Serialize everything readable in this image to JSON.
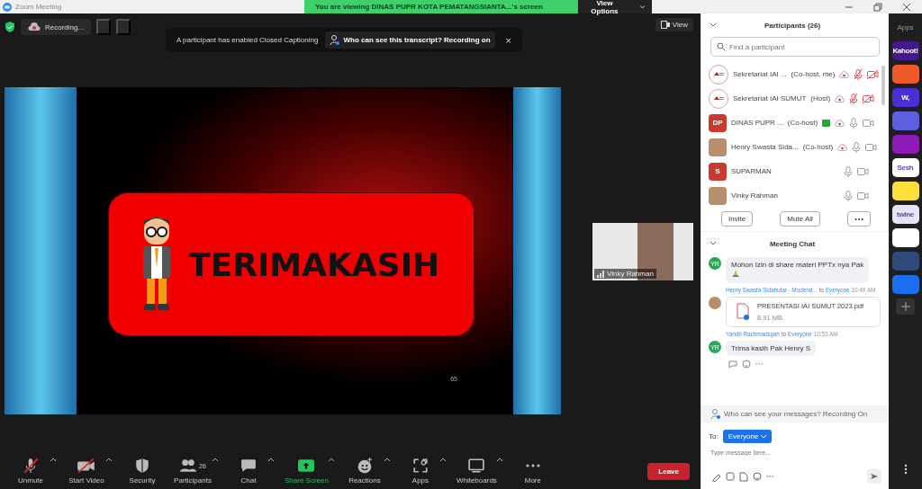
{
  "window": {
    "title": "Zoom Meeting"
  },
  "share_banner": {
    "text": "You are viewing DINAS PUPR KOTA PEMATANGSIANTA...'s screen",
    "button": "View Options"
  },
  "recording": {
    "label": "Recording..."
  },
  "caption_notice": {
    "text": "A participant has enabled Closed Captioning",
    "link": "Who can see this transcript? Recording on",
    "close": "×"
  },
  "view_button": "View",
  "slide": {
    "title": "TERIMAKASIH",
    "page": "65"
  },
  "thumbnail": {
    "name": "Vinky Rahman"
  },
  "toolbar": [
    {
      "kind": "mic",
      "label": "Unmute",
      "off": true
    },
    {
      "kind": "video",
      "label": "Start Video",
      "off": true
    },
    {
      "kind": "security",
      "label": "Security"
    },
    {
      "kind": "participants",
      "label": "Participants",
      "count": "26"
    },
    {
      "kind": "chat",
      "label": "Chat"
    },
    {
      "kind": "share",
      "label": "Share Screen"
    },
    {
      "kind": "reactions",
      "label": "Reactions"
    },
    {
      "kind": "apps",
      "label": "Apps"
    },
    {
      "kind": "whiteboards",
      "label": "Whiteboards"
    },
    {
      "kind": "more",
      "label": "More"
    }
  ],
  "leave_button": "Leave",
  "participants": {
    "title": "Participants (26)",
    "search_placeholder": "Find a participant",
    "rows": [
      {
        "name": "Sekretariat IAI ...",
        "role": "(Co-host, me)",
        "avatar": {
          "kind": "logo"
        },
        "recording": true,
        "sharing": false,
        "mic_muted": true,
        "video_off": true
      },
      {
        "name": "Sekretariat IAI SUMUT",
        "role": "(Host)",
        "avatar": {
          "kind": "logo"
        },
        "recording": true,
        "sharing": false,
        "mic_muted": true,
        "video_off": true
      },
      {
        "name": "DINAS PUPR ...",
        "role": "(Co-host)",
        "avatar": {
          "kind": "initials",
          "initials": "DP"
        },
        "recording": true,
        "sharing": true,
        "mic_muted": false,
        "video_off": false
      },
      {
        "name": "Henry Swasta Sida...",
        "role": "(Co-host)",
        "avatar": {
          "kind": "photo"
        },
        "recording": true,
        "sharing": false,
        "mic_muted": false,
        "video_off": false
      },
      {
        "name": "SUPARMAN",
        "avatar": {
          "kind": "initials",
          "initials": "S"
        },
        "recording": false,
        "sharing": false,
        "mic_muted": false,
        "video_off": false
      },
      {
        "name": "Vinky Rahman",
        "avatar": {
          "kind": "photo"
        },
        "recording": false,
        "sharing": false,
        "mic_muted": false,
        "video_off": false
      }
    ],
    "buttons": [
      "Invite",
      "Mute All"
    ]
  },
  "chat": {
    "title": "Meeting Chat",
    "messages": [
      {
        "kind": "text",
        "avatar": {
          "kind": "initials",
          "initials": "YR"
        },
        "text": "Mohon Izin di share materi PPTx nya Pak",
        "prayer_emoji": true
      },
      {
        "kind": "file",
        "avatar": {
          "kind": "photo"
        },
        "sender": "Henry Swasta Sidabutar - Moderat...",
        "to": "to",
        "recipient": "Everyone",
        "time": "10:49 AM",
        "file_name": "PRESENTASI IAI SUMUT 2023.pdf",
        "file_size": "8.91 MB"
      },
      {
        "kind": "text",
        "avatar": {
          "kind": "initials",
          "initials": "YR"
        },
        "sender": "Yandri Rachmadsyah",
        "to": "to",
        "recipient": "Everyone",
        "time": "10:53 AM",
        "text": "Trima kasih Pak Henry S",
        "prayer_emoji": false
      }
    ],
    "privacy": "Who can see your messages? Recording On",
    "to_label": "To:",
    "recipient": "Everyone",
    "placeholder": "Type message here..."
  },
  "apps": {
    "title": "Apps",
    "items": [
      {
        "label": "Kahoot!",
        "color": "#46178f"
      },
      {
        "color": "#f05a28"
      },
      {
        "label": "W,",
        "color": "#4b2fd6"
      },
      {
        "color": "#5b5fe0"
      },
      {
        "color": "#8e1bb5"
      },
      {
        "label": "Sesh",
        "color": "#ffffff"
      },
      {
        "color": "#ffe03a"
      },
      {
        "label": "twine",
        "color": "#e6e4f5"
      },
      {
        "color": "#ffffff"
      },
      {
        "color": "#2e4a7a"
      },
      {
        "color": "#1a6ff0"
      }
    ]
  }
}
